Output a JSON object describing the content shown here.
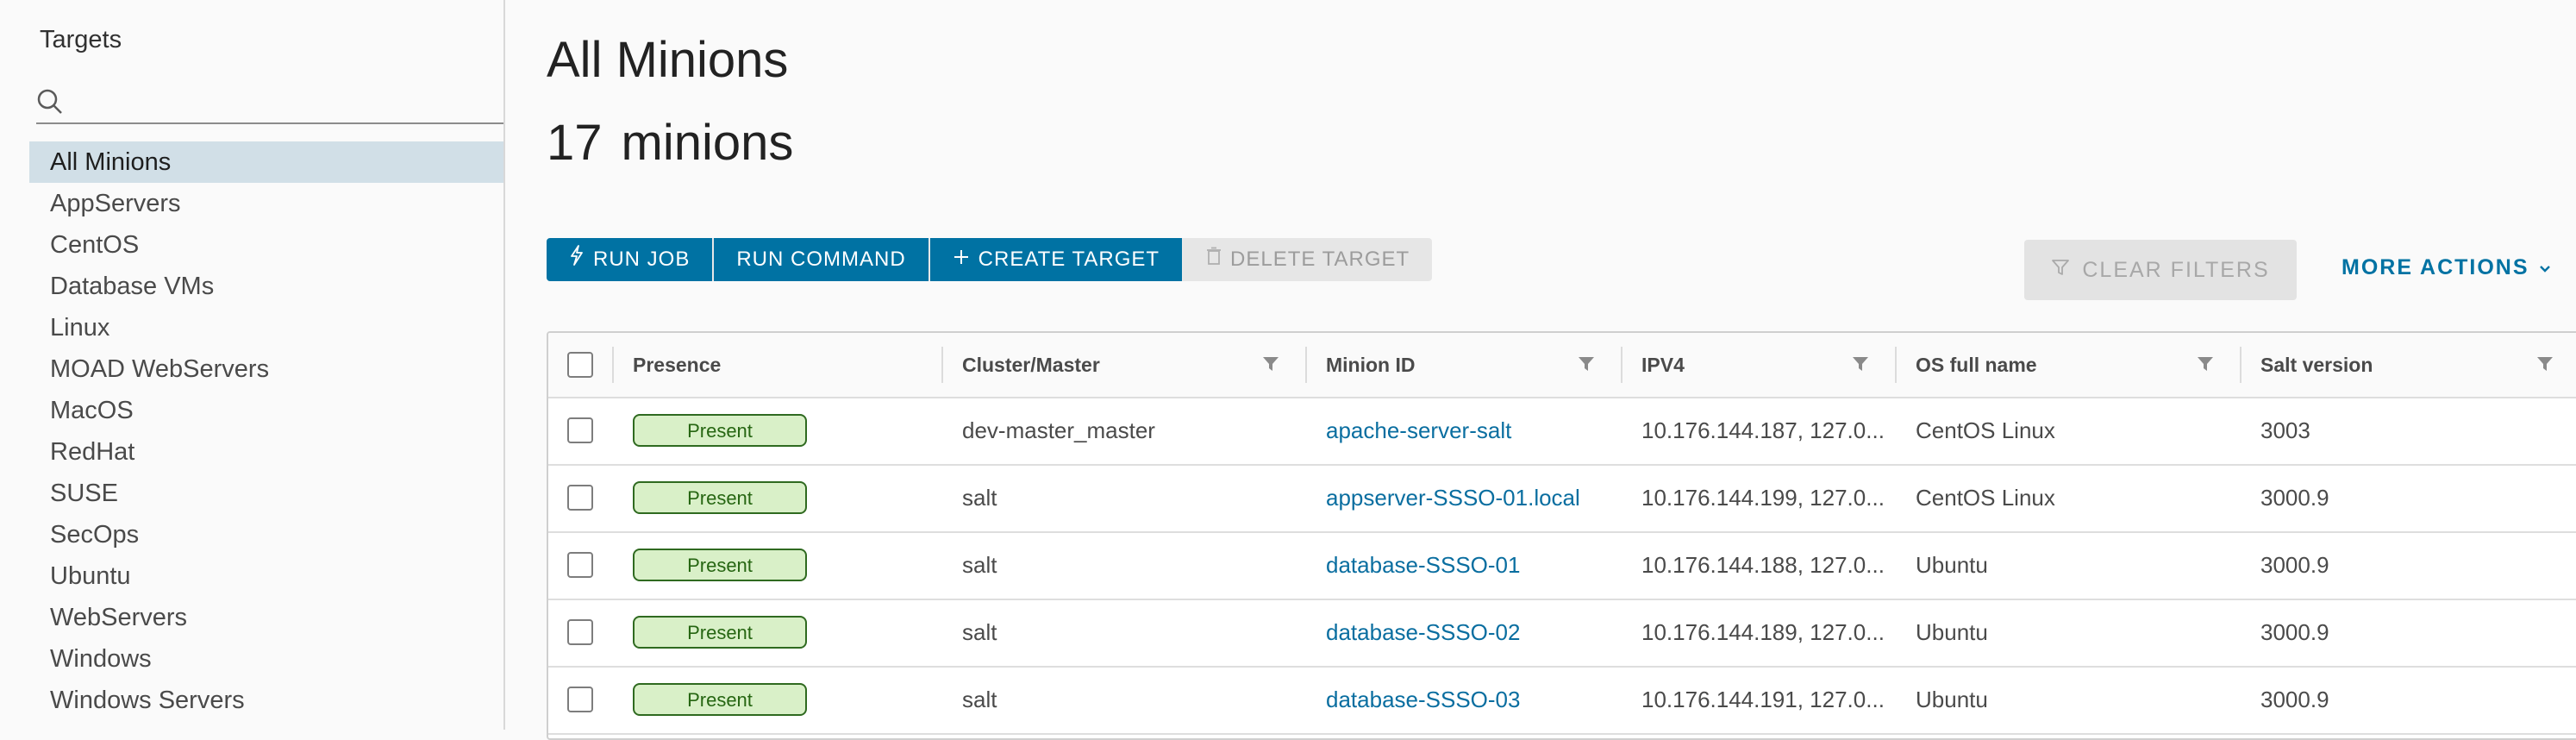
{
  "sidebar": {
    "title": "Targets",
    "search_placeholder": "",
    "items": [
      {
        "label": "All Minions"
      },
      {
        "label": "AppServers"
      },
      {
        "label": "CentOS"
      },
      {
        "label": "Database VMs"
      },
      {
        "label": "Linux"
      },
      {
        "label": "MOAD WebServers"
      },
      {
        "label": "MacOS"
      },
      {
        "label": "RedHat"
      },
      {
        "label": "SUSE"
      },
      {
        "label": "SecOps"
      },
      {
        "label": "Ubuntu"
      },
      {
        "label": "WebServers"
      },
      {
        "label": "Windows"
      },
      {
        "label": "Windows Servers"
      }
    ],
    "active_index": 0
  },
  "main": {
    "title": "All Minions",
    "count": "17",
    "count_label": "minions"
  },
  "toolbar": {
    "run_job": "RUN JOB",
    "run_command": "RUN COMMAND",
    "create_target": "CREATE TARGET",
    "delete_target": "DELETE TARGET",
    "clear_filters": "CLEAR FILTERS",
    "more_actions": "MORE ACTIONS"
  },
  "table": {
    "columns": [
      "Presence",
      "Cluster/Master",
      "Minion ID",
      "IPV4",
      "OS full name",
      "Salt version"
    ],
    "rows": [
      {
        "presence": "Present",
        "cluster": "dev-master_master",
        "minion_id": "apache-server-salt",
        "ipv4": "10.176.144.187, 127.0...",
        "os": "CentOS Linux",
        "salt": "3003"
      },
      {
        "presence": "Present",
        "cluster": "salt",
        "minion_id": "appserver-SSSO-01.local",
        "ipv4": "10.176.144.199, 127.0...",
        "os": "CentOS Linux",
        "salt": "3000.9"
      },
      {
        "presence": "Present",
        "cluster": "salt",
        "minion_id": "database-SSSO-01",
        "ipv4": "10.176.144.188, 127.0...",
        "os": "Ubuntu",
        "salt": "3000.9"
      },
      {
        "presence": "Present",
        "cluster": "salt",
        "minion_id": "database-SSSO-02",
        "ipv4": "10.176.144.189, 127.0...",
        "os": "Ubuntu",
        "salt": "3000.9"
      },
      {
        "presence": "Present",
        "cluster": "salt",
        "minion_id": "database-SSSO-03",
        "ipv4": "10.176.144.191, 127.0...",
        "os": "Ubuntu",
        "salt": "3000.9"
      }
    ]
  },
  "colors": {
    "accent": "#0072a3",
    "active_nav": "#d1dfe7",
    "badge_bg": "#d9f0c8",
    "badge_border": "#2f6a20"
  },
  "icons": [
    "search-icon",
    "lightning-icon",
    "plus-icon",
    "trash-icon",
    "filter-icon",
    "chevron-down-icon"
  ]
}
